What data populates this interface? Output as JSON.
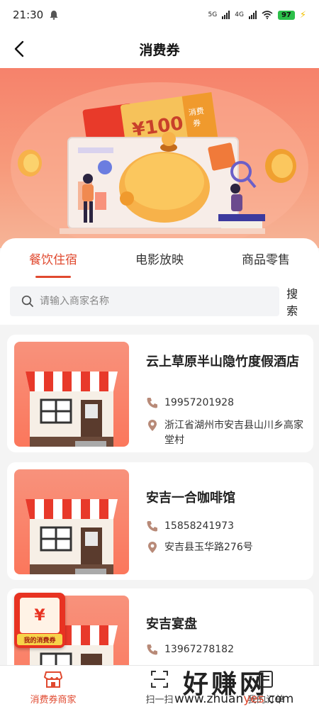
{
  "status": {
    "time": "21:30",
    "net1": "5G",
    "net2": "4G",
    "battery": "97"
  },
  "header": {
    "title": "消费券"
  },
  "tabs": [
    {
      "label": "餐饮住宿",
      "active": true
    },
    {
      "label": "电影放映",
      "active": false
    },
    {
      "label": "商品零售",
      "active": false
    }
  ],
  "search": {
    "placeholder": "请输入商家名称",
    "button_label": "搜索"
  },
  "merchants": [
    {
      "name": "云上草原半山隐竹度假酒店",
      "phone": "19957201928",
      "address": "浙江省湖州市安吉县山川乡高家堂村"
    },
    {
      "name": "安吉一合咖啡馆",
      "phone": "15858241973",
      "address": "安吉县玉华路276号"
    },
    {
      "name": "安吉宴盘",
      "phone": "13967278182",
      "address": ""
    }
  ],
  "coupon_badge": {
    "symbol": "¥",
    "label": "我的消费券"
  },
  "bottom_nav": [
    {
      "label": "消费券商家",
      "icon": "shop-icon",
      "active": true
    },
    {
      "label": "扫一扫",
      "icon": "scan-icon",
      "active": false
    },
    {
      "label": "我的订单",
      "icon": "order-icon",
      "active": false
    }
  ],
  "banner": {
    "ticket_text": "¥100",
    "ticket_side": "消费券"
  },
  "watermark": {
    "text": "好赚网",
    "url_a": "www.zhuan",
    "url_b": "yes",
    "url_c": ".com"
  },
  "colors": {
    "accent": "#e0492f",
    "banner": "#f6826b"
  }
}
